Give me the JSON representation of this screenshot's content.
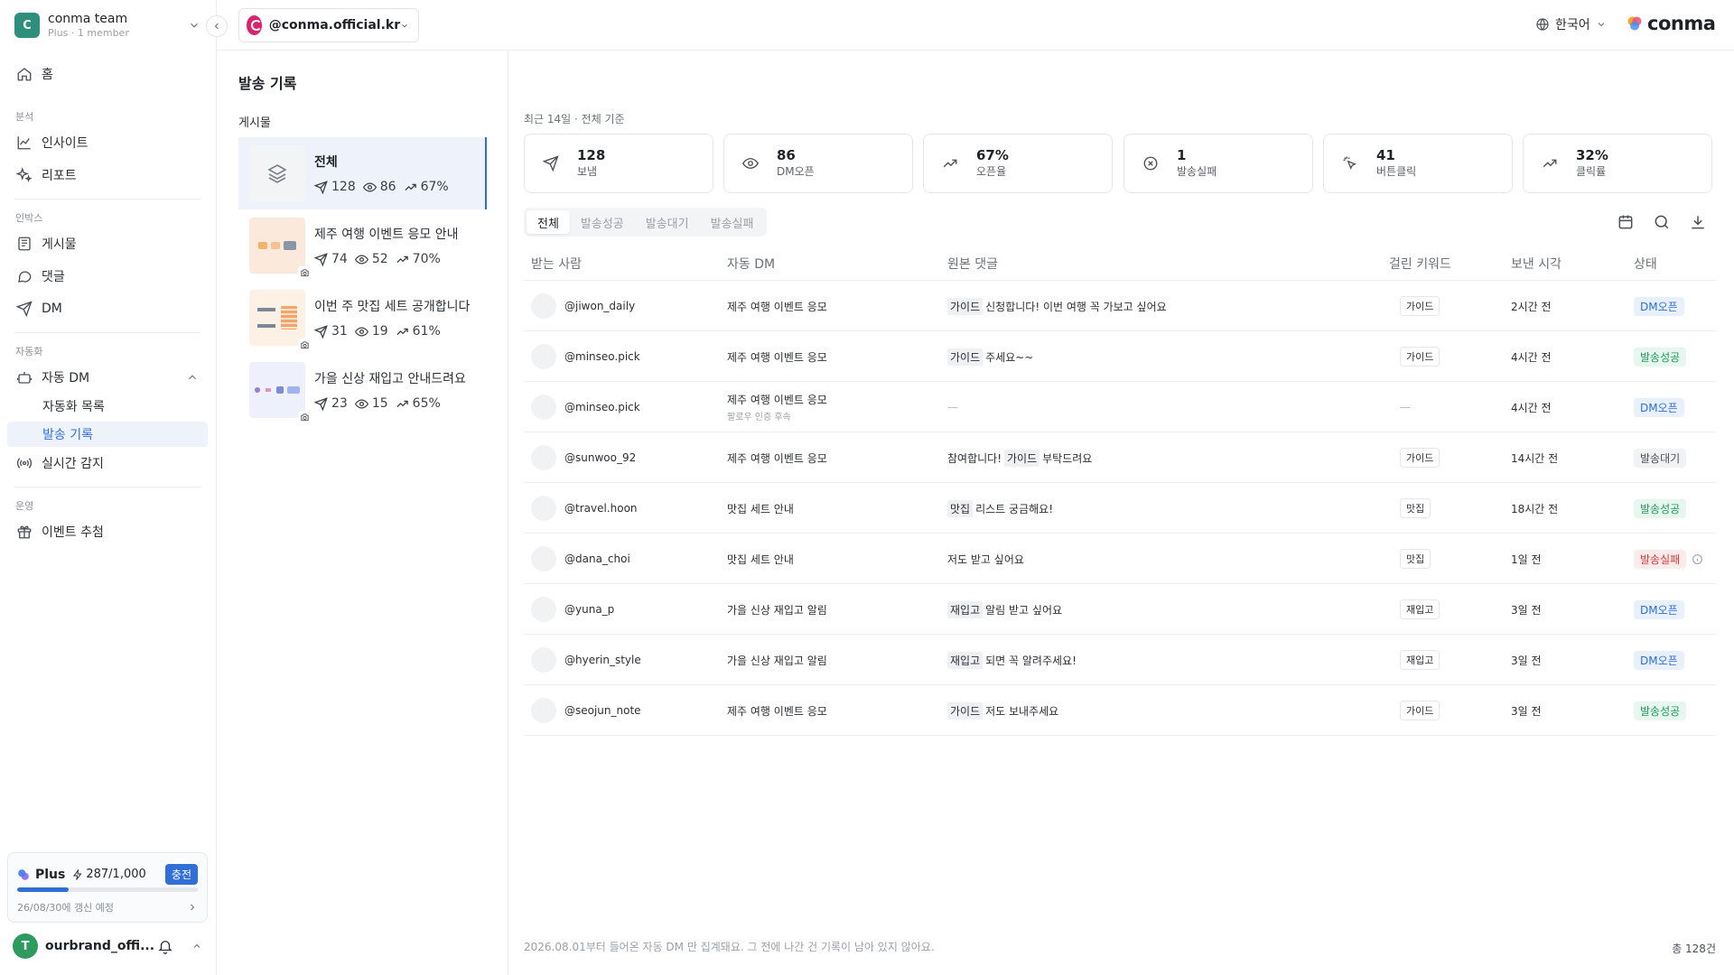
{
  "sidebar": {
    "team_initial": "C",
    "team_name": "conma team",
    "team_sub": "Plus · 1 member",
    "home": "홈",
    "sections": {
      "analytics": "분석",
      "inbox": "인박스",
      "automation": "자동화",
      "operation": "운영"
    },
    "insight": "인사이트",
    "report": "리포트",
    "posts": "게시물",
    "comments": "댓글",
    "dm": "DM",
    "auto_dm": "자동 DM",
    "auto_list": "자동화 목록",
    "send_history": "발송 기록",
    "realtime": "실시간 감지",
    "event_draw": "이벤트 추첨",
    "plan": {
      "name": "Plus",
      "credits": "287/1,000",
      "progress": 0.287,
      "charge": "충전",
      "renew": "26/08/30에 갱신 예정"
    },
    "user": {
      "initial": "T",
      "name": "ourbrand_offi..."
    }
  },
  "topbar": {
    "account": "@conma.official.kr",
    "language": "한국어",
    "brand": "conma"
  },
  "posts_panel": {
    "title": "발송 기록",
    "label": "게시물",
    "items": [
      {
        "title": "전체",
        "sent": "128",
        "opened": "86",
        "rate": "67%"
      },
      {
        "title": "제주 여행 이벤트 응모 안내",
        "sent": "74",
        "opened": "52",
        "rate": "70%"
      },
      {
        "title": "이번 주 맛집 세트 공개합니다",
        "sent": "31",
        "opened": "19",
        "rate": "61%"
      },
      {
        "title": "가을 신상 재입고 안내드려요",
        "sent": "23",
        "opened": "15",
        "rate": "65%"
      }
    ]
  },
  "main": {
    "period": "최근 14일 · 전체 기준",
    "stats": [
      {
        "value": "128",
        "label": "보냄",
        "icon": "send-icon"
      },
      {
        "value": "86",
        "label": "DM오픈",
        "icon": "eye-icon"
      },
      {
        "value": "67%",
        "label": "오픈율",
        "icon": "trend-up-icon"
      },
      {
        "value": "1",
        "label": "발송실패",
        "icon": "x-circle-icon"
      },
      {
        "value": "41",
        "label": "버튼클릭",
        "icon": "click-icon"
      },
      {
        "value": "32%",
        "label": "클릭률",
        "icon": "trend-up-icon"
      }
    ],
    "tabs": [
      "전체",
      "발송성공",
      "발송대기",
      "발송실패"
    ],
    "columns": [
      "받는 사람",
      "자동 DM",
      "원본 댓글",
      "걸린 키워드",
      "보낸 시각",
      "상태"
    ],
    "rows": [
      {
        "recipient": "@jiwon_daily",
        "dm": "제주 여행 이벤트 응모",
        "dm_sub": "",
        "kw_mark": "가이드",
        "comment": "신청합니다! 이번 여행 꼭 가보고 싶어요",
        "keyword": "가이드",
        "time": "2시간 전",
        "status": "DM오픈",
        "status_type": "open"
      },
      {
        "recipient": "@minseo.pick",
        "dm": "제주 여행 이벤트 응모",
        "dm_sub": "",
        "kw_mark": "가이드",
        "comment": "주세요~~",
        "keyword": "가이드",
        "time": "4시간 전",
        "status": "발송성공",
        "status_type": "ok"
      },
      {
        "recipient": "@minseo.pick",
        "dm": "제주 여행 이벤트 응모",
        "dm_sub": "팔로우 인증 후속",
        "kw_mark": "",
        "comment": "—",
        "keyword": "—",
        "time": "4시간 전",
        "status": "DM오픈",
        "status_type": "open"
      },
      {
        "recipient": "@sunwoo_92",
        "dm": "제주 여행 이벤트 응모",
        "dm_sub": "",
        "kw_pre": "참여합니다!",
        "kw_mark": "가이드",
        "comment": "부탁드려요",
        "keyword": "가이드",
        "time": "14시간 전",
        "status": "발송대기",
        "status_type": "wait"
      },
      {
        "recipient": "@travel.hoon",
        "dm": "맛집 세트 안내",
        "dm_sub": "",
        "kw_mark": "맛집",
        "comment": "리스트 궁금해요!",
        "keyword": "맛집",
        "time": "18시간 전",
        "status": "발송성공",
        "status_type": "ok"
      },
      {
        "recipient": "@dana_choi",
        "dm": "맛집 세트 안내",
        "dm_sub": "",
        "kw_mark": "",
        "comment": "저도 받고 싶어요",
        "keyword": "맛집",
        "time": "1일 전",
        "status": "발송실패",
        "status_type": "fail"
      },
      {
        "recipient": "@yuna_p",
        "dm": "가을 신상 재입고 알림",
        "dm_sub": "",
        "kw_mark": "재입고",
        "comment": "알림 받고 싶어요",
        "keyword": "재입고",
        "time": "3일 전",
        "status": "DM오픈",
        "status_type": "open"
      },
      {
        "recipient": "@hyerin_style",
        "dm": "가을 신상 재입고 알림",
        "dm_sub": "",
        "kw_mark": "재입고",
        "comment": "되면 꼭 알려주세요!",
        "keyword": "재입고",
        "time": "3일 전",
        "status": "DM오픈",
        "status_type": "open"
      },
      {
        "recipient": "@seojun_note",
        "dm": "제주 여행 이벤트 응모",
        "dm_sub": "",
        "kw_mark": "가이드",
        "comment": "저도 보내주세요",
        "keyword": "가이드",
        "time": "3일 전",
        "status": "발송성공",
        "status_type": "ok"
      }
    ],
    "footnote": "2026.08.01부터 들어온 자동 DM 만 집계돼요. 그 전에 나간 건 기록이 남아 있지 않아요.",
    "total": "총 128건"
  },
  "colors": {
    "accent": "#2f6fd6",
    "team": "#2f8f7d",
    "user": "#2e9b5e"
  }
}
